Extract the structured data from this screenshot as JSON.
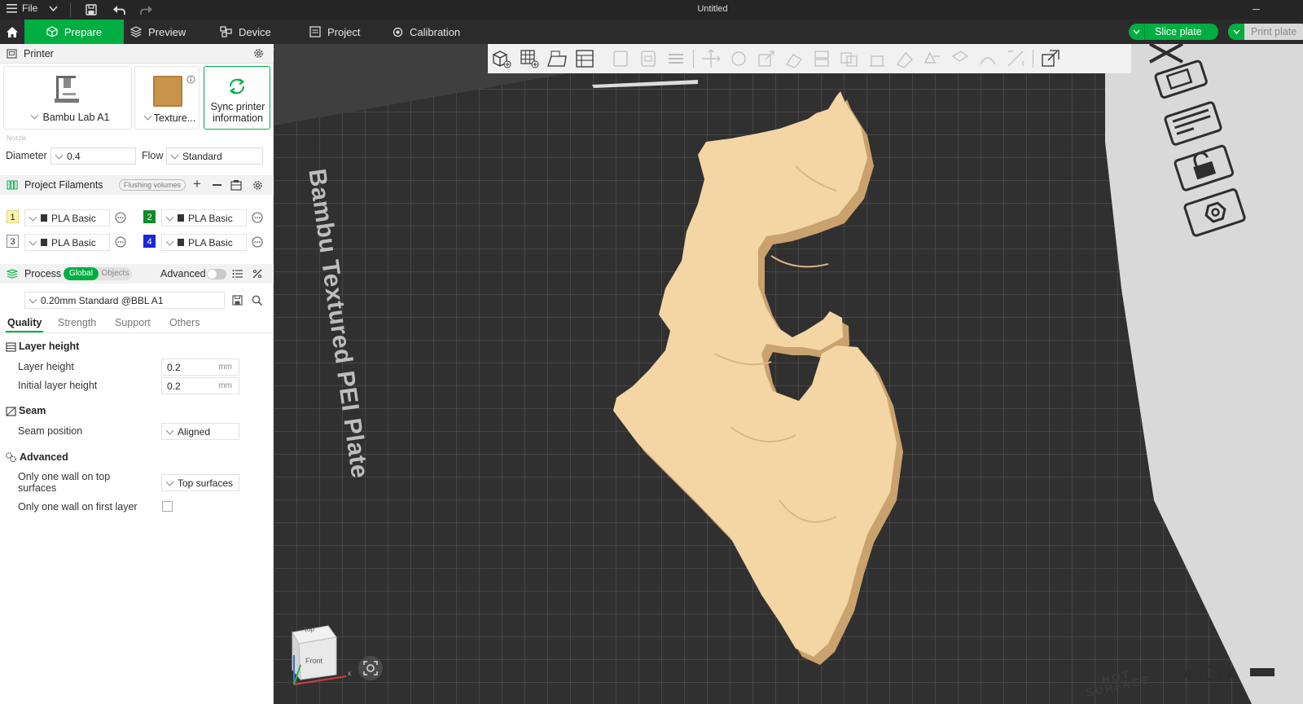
{
  "titlebar": {
    "file_label": "File",
    "window_title": "Untitled"
  },
  "tabs": [
    {
      "label": "Prepare"
    },
    {
      "label": "Preview"
    },
    {
      "label": "Device"
    },
    {
      "label": "Project"
    },
    {
      "label": "Calibration"
    }
  ],
  "actions": {
    "slice_label": "Slice plate",
    "print_label": "Print plate"
  },
  "printer": {
    "section_title": "Printer",
    "printer_name": "Bambu Lab A1",
    "plate_type": "Texture...",
    "sync_label_line1": "Sync printer",
    "sync_label_line2": "information",
    "nozzle_caption": "Nozzle",
    "diameter_label": "Diameter",
    "diameter_value": "0.4",
    "flow_label": "Flow",
    "flow_value": "Standard"
  },
  "filaments": {
    "section_title": "Project Filaments",
    "flushing_label": "Flushing volumes",
    "slots": [
      {
        "number": "1",
        "name": "PLA Basic",
        "color": "#fff3a6"
      },
      {
        "number": "2",
        "name": "PLA Basic",
        "color": "#0f8a2b"
      },
      {
        "number": "3",
        "name": "PLA Basic",
        "color": "#ffffff"
      },
      {
        "number": "4",
        "name": "PLA Basic",
        "color": "#1a28d8"
      }
    ]
  },
  "process": {
    "section_title": "Process",
    "global_label": "Global",
    "objects_label": "Objects",
    "advanced_label": "Advanced",
    "preset": "0.20mm Standard @BBL A1",
    "subtabs": [
      "Quality",
      "Strength",
      "Support",
      "Others"
    ],
    "groups": {
      "layer_height_title": "Layer height",
      "layer_height_label": "Layer height",
      "layer_height_value": "0.2",
      "initial_layer_label": "Initial layer height",
      "initial_layer_value": "0.2",
      "unit": "mm",
      "seam_title": "Seam",
      "seam_position_label": "Seam position",
      "seam_position_value": "Aligned",
      "advanced_title": "Advanced",
      "one_wall_top_label_line1": "Only one wall on top",
      "one_wall_top_label_line2": "surfaces",
      "one_wall_top_value": "Top surfaces",
      "one_wall_first_label": "Only one wall on first layer",
      "one_wall_first_checked": false
    }
  },
  "viewport": {
    "plate_label": "Bambu Textured PEI Plate",
    "cube_top": "Top",
    "cube_front": "Front",
    "hot_surface_label": "HOT SURFACE",
    "model_color": "#f3d6a4",
    "plate_color": "#2e2e2e",
    "accent": "#00ae42"
  }
}
